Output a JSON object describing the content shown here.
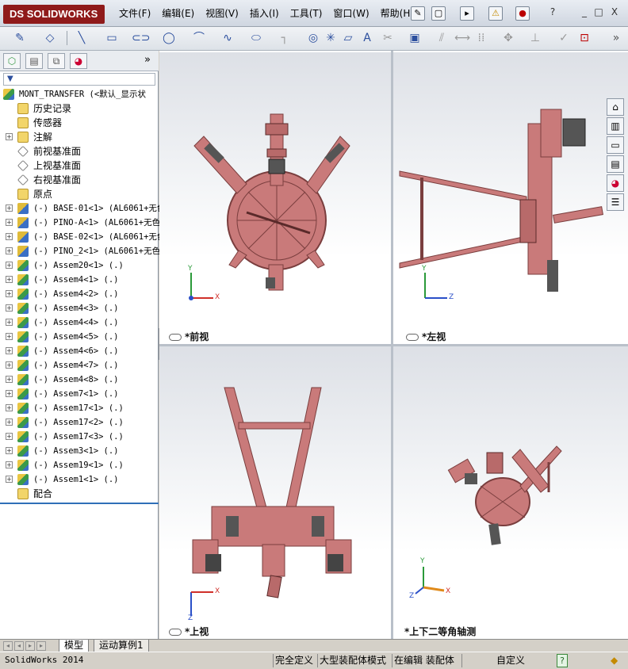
{
  "app": {
    "logo_text": "SOLIDWORKS",
    "logo_prefix": "DS"
  },
  "menus": [
    "文件(F)",
    "编辑(E)",
    "视图(V)",
    "插入(I)",
    "工具(T)",
    "窗口(W)",
    "帮助(H)"
  ],
  "window_controls": {
    "help": "?",
    "minimize": "_",
    "maximize": "□",
    "close": "X"
  },
  "left_panel": {
    "tabs": [
      "feature-manager",
      "property-manager",
      "configuration-manager",
      "display-manager"
    ],
    "root": "MONT_TRANSFER  (<默认_显示状",
    "tree": [
      {
        "label": "历史记录",
        "icon": "history-icon",
        "expander": false,
        "zh": true
      },
      {
        "label": "传感器",
        "icon": "sensor-icon",
        "expander": false,
        "zh": true
      },
      {
        "label": "注解",
        "icon": "annotation-icon",
        "expander": true,
        "zh": true
      },
      {
        "label": "前视基准面",
        "icon": "plane-icon",
        "expander": false,
        "zh": true
      },
      {
        "label": "上视基准面",
        "icon": "plane-icon",
        "expander": false,
        "zh": true
      },
      {
        "label": "右视基准面",
        "icon": "plane-icon",
        "expander": false,
        "zh": true
      },
      {
        "label": "原点",
        "icon": "origin-icon",
        "expander": false,
        "zh": true
      },
      {
        "label": "(-) BASE-01<1> (AL6061+无色",
        "icon": "part-icon",
        "expander": true,
        "zh": false
      },
      {
        "label": "(-) PINO-A<1> (AL6061+无色",
        "icon": "part-icon",
        "expander": true,
        "zh": false
      },
      {
        "label": "(-) BASE-02<1> (AL6061+无色",
        "icon": "part-icon",
        "expander": true,
        "zh": false
      },
      {
        "label": "(-) PINO_2<1> (AL6061+无色",
        "icon": "part-icon",
        "expander": true,
        "zh": false
      },
      {
        "label": "(-) Assem20<1> (.)",
        "icon": "assembly-icon",
        "expander": true,
        "zh": false
      },
      {
        "label": "(-) Assem4<1> (.)",
        "icon": "assembly-icon",
        "expander": true,
        "zh": false
      },
      {
        "label": "(-) Assem4<2> (.)",
        "icon": "assembly-icon",
        "expander": true,
        "zh": false
      },
      {
        "label": "(-) Assem4<3> (.)",
        "icon": "assembly-icon",
        "expander": true,
        "zh": false
      },
      {
        "label": "(-) Assem4<4> (.)",
        "icon": "assembly-icon",
        "expander": true,
        "zh": false
      },
      {
        "label": "(-) Assem4<5> (.)",
        "icon": "assembly-icon",
        "expander": true,
        "zh": false
      },
      {
        "label": "(-) Assem4<6> (.)",
        "icon": "assembly-icon",
        "expander": true,
        "zh": false
      },
      {
        "label": "(-) Assem4<7> (.)",
        "icon": "assembly-icon",
        "expander": true,
        "zh": false
      },
      {
        "label": "(-) Assem4<8> (.)",
        "icon": "assembly-icon",
        "expander": true,
        "zh": false
      },
      {
        "label": "(-) Assem7<1> (.)",
        "icon": "assembly-icon",
        "expander": true,
        "zh": false
      },
      {
        "label": "(-) Assem17<1> (.)",
        "icon": "assembly-icon",
        "expander": true,
        "zh": false
      },
      {
        "label": "(-) Assem17<2> (.)",
        "icon": "assembly-icon",
        "expander": true,
        "zh": false
      },
      {
        "label": "(-) Assem17<3> (.)",
        "icon": "assembly-icon",
        "expander": true,
        "zh": false
      },
      {
        "label": "(-) Assem3<1> (.)",
        "icon": "assembly-icon",
        "expander": true,
        "zh": false
      },
      {
        "label": "(-) Assem19<1> (.)",
        "icon": "assembly-icon",
        "expander": true,
        "zh": false
      },
      {
        "label": "(-) Assem1<1> (.)",
        "icon": "assembly-icon",
        "expander": true,
        "zh": false
      },
      {
        "label": "配合",
        "icon": "mates-icon",
        "expander": false,
        "zh": true
      }
    ]
  },
  "viewports": {
    "front": "*前视",
    "left": "*左视",
    "top": "*上视",
    "iso": "*上下二等角轴测"
  },
  "triad": {
    "x": "X",
    "y": "Y",
    "z": "Z"
  },
  "bottom_tabs": [
    "模型",
    "运动算例1"
  ],
  "status": {
    "app_name": "SolidWorks 2014",
    "fully_defined": "完全定义",
    "large_assembly": "大型装配体模式",
    "editing": "在编辑 装配体",
    "custom": "自定义",
    "help": "?"
  },
  "colors": {
    "model": "#c97a7a",
    "model_dark": "#7a3e3e",
    "accent": "#2f6fb8",
    "axis_x": "#d0302a",
    "axis_y": "#2b9a3a",
    "axis_z": "#2a4fc8"
  }
}
